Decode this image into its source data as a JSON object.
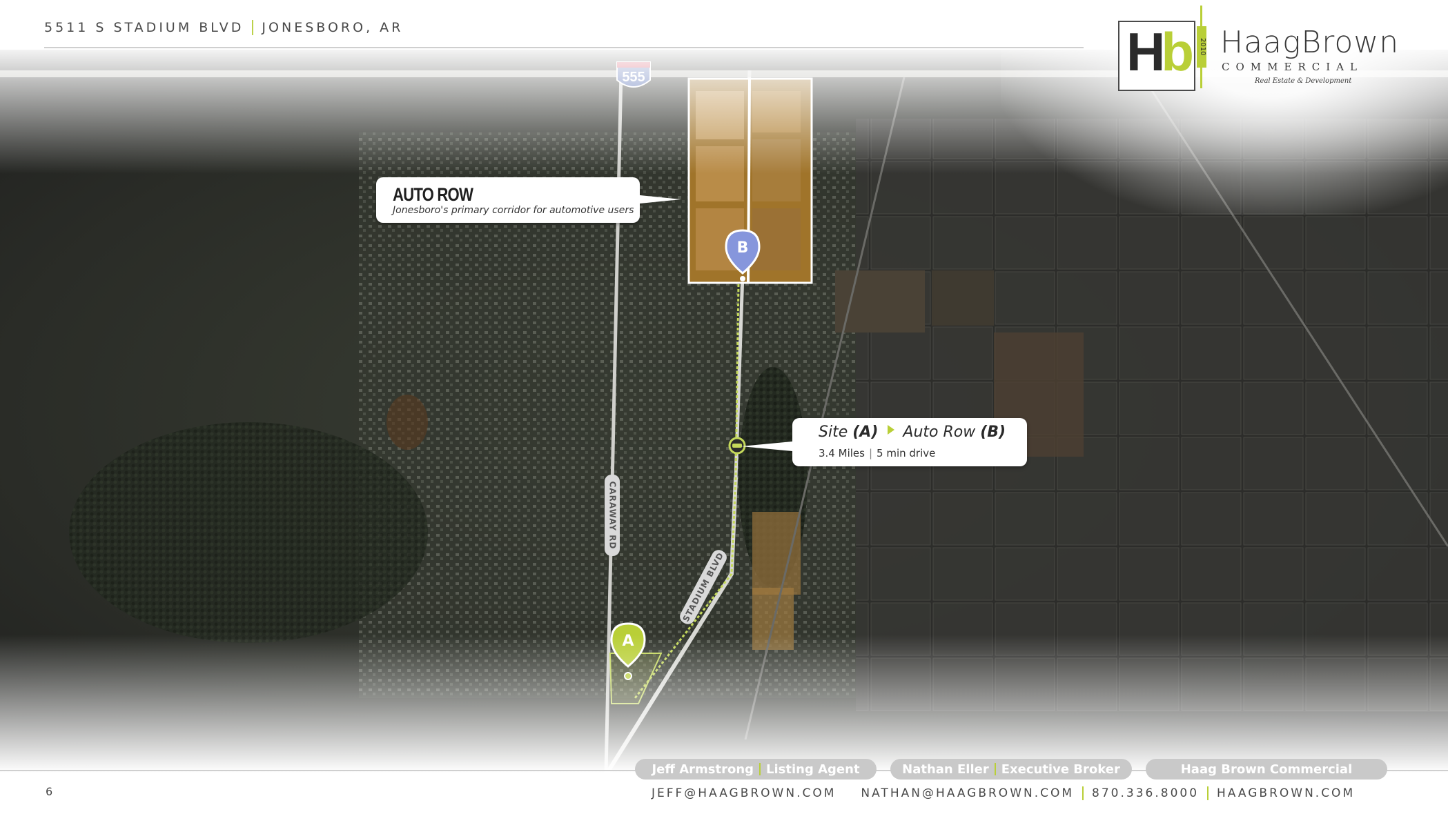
{
  "header": {
    "address": "5511 S STADIUM BLVD",
    "city": "JONESBORO, AR"
  },
  "logo": {
    "mark_h": "H",
    "mark_b": "b",
    "year": "2010",
    "name": "HaagBrown",
    "subtitle": "COMMERCIAL",
    "tagline": "Real Estate & Development"
  },
  "map": {
    "highway_shield": "555",
    "marker_a": "A",
    "marker_b": "B",
    "roads": {
      "caraway": "CARAWAY RD",
      "stadium": "STADIUM BLVD"
    },
    "accent_color": "#b9cf37",
    "marker_b_color": "#7e8fd4"
  },
  "callouts": {
    "auto_row": {
      "title": "AUTO ROW",
      "subtitle": "Jonesboro's primary corridor for automotive users"
    },
    "route": {
      "from_prefix": "Site",
      "from_bold": "(A)",
      "to_prefix": "Auto Row",
      "to_bold": "(B)",
      "distance": "3.4 Miles",
      "drive_time": "5 min drive"
    }
  },
  "footer": {
    "page_number": "6",
    "agents": [
      {
        "name": "Jeff Armstrong",
        "role": "Listing Agent"
      },
      {
        "name": "Nathan Eller",
        "role": "Executive Broker"
      }
    ],
    "company": "Haag Brown Commercial",
    "email_jeff": "JEFF@HAAGBROWN.COM",
    "email_nathan": "NATHAN@HAAGBROWN.COM",
    "phone": "870.336.8000",
    "website": "HAAGBROWN.COM"
  }
}
